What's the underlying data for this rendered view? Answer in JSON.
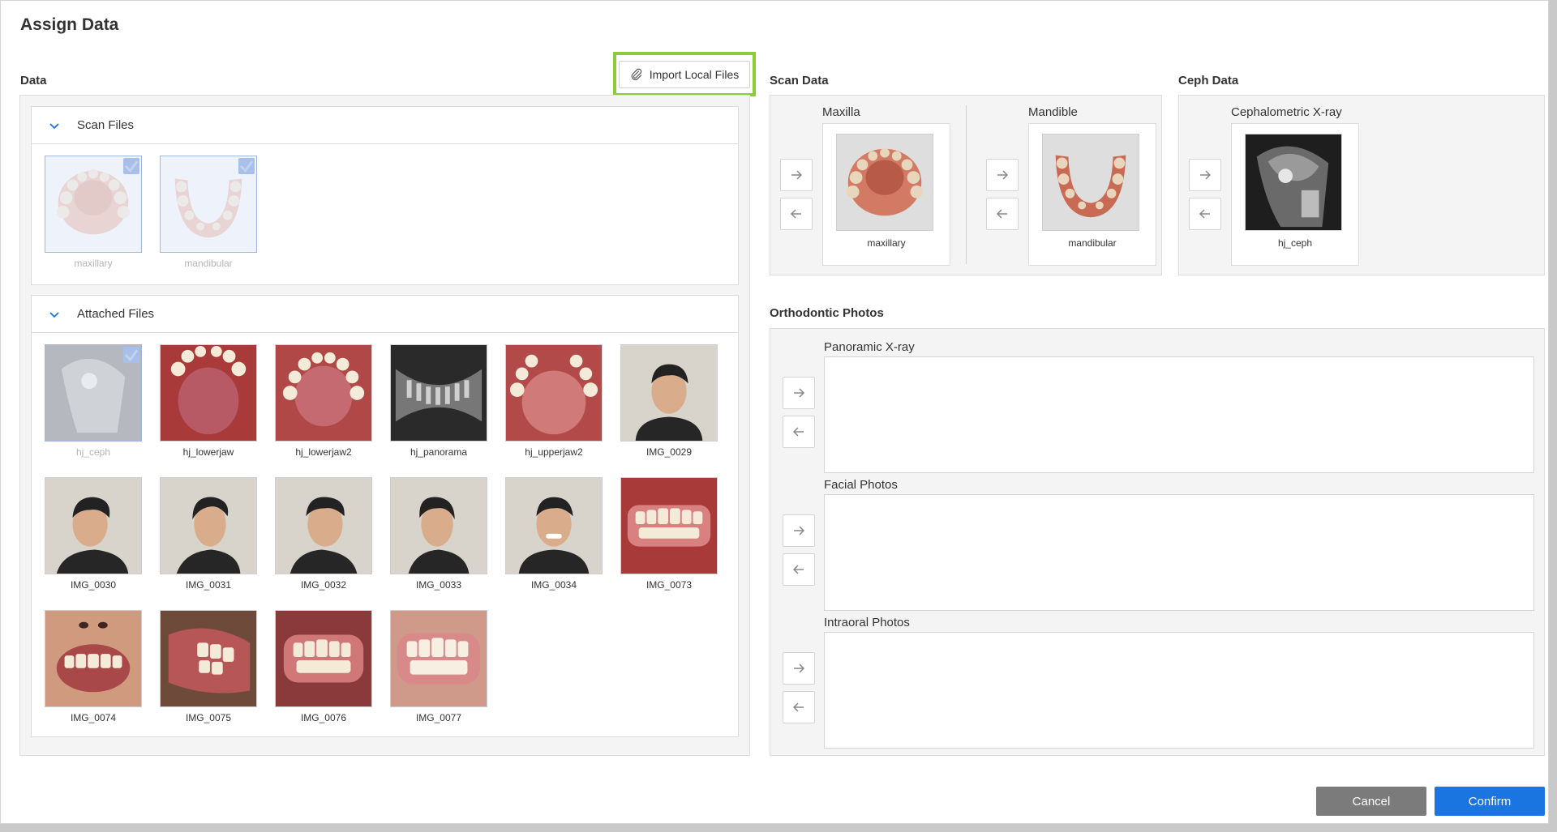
{
  "dialog": {
    "title": "Assign Data"
  },
  "data_panel": {
    "label": "Data",
    "import_button": "Import Local Files",
    "scan_files": {
      "title": "Scan Files",
      "items": [
        {
          "name": "maxillary",
          "assigned": true
        },
        {
          "name": "mandibular",
          "assigned": true
        }
      ]
    },
    "attached_files": {
      "title": "Attached Files",
      "items": [
        {
          "name": "hj_ceph",
          "assigned": true
        },
        {
          "name": "hj_lowerjaw",
          "assigned": false
        },
        {
          "name": "hj_lowerjaw2",
          "assigned": false
        },
        {
          "name": "hj_panorama",
          "assigned": false
        },
        {
          "name": "hj_upperjaw2",
          "assigned": false
        },
        {
          "name": "IMG_0029",
          "assigned": false
        },
        {
          "name": "IMG_0030",
          "assigned": false
        },
        {
          "name": "IMG_0031",
          "assigned": false
        },
        {
          "name": "IMG_0032",
          "assigned": false
        },
        {
          "name": "IMG_0033",
          "assigned": false
        },
        {
          "name": "IMG_0034",
          "assigned": false
        },
        {
          "name": "IMG_0073",
          "assigned": false
        },
        {
          "name": "IMG_0074",
          "assigned": false
        },
        {
          "name": "IMG_0075",
          "assigned": false
        },
        {
          "name": "IMG_0076",
          "assigned": false
        },
        {
          "name": "IMG_0077",
          "assigned": false
        }
      ]
    }
  },
  "scan_data": {
    "label": "Scan Data",
    "maxilla": {
      "label": "Maxilla",
      "file": "maxillary"
    },
    "mandible": {
      "label": "Mandible",
      "file": "mandibular"
    }
  },
  "ceph_data": {
    "label": "Ceph Data",
    "ceph": {
      "label": "Cephalometric X-ray",
      "file": "hj_ceph"
    }
  },
  "ortho_photos": {
    "label": "Orthodontic Photos",
    "panoramic": {
      "label": "Panoramic X-ray"
    },
    "facial": {
      "label": "Facial Photos"
    },
    "intraoral": {
      "label": "Intraoral Photos"
    }
  },
  "footer": {
    "cancel": "Cancel",
    "confirm": "Confirm"
  },
  "colors": {
    "accent": "#1b75e0",
    "cancel": "#7b7b7b",
    "highlight": "#8ccb3a",
    "checkbox": "#a8c0e8"
  }
}
